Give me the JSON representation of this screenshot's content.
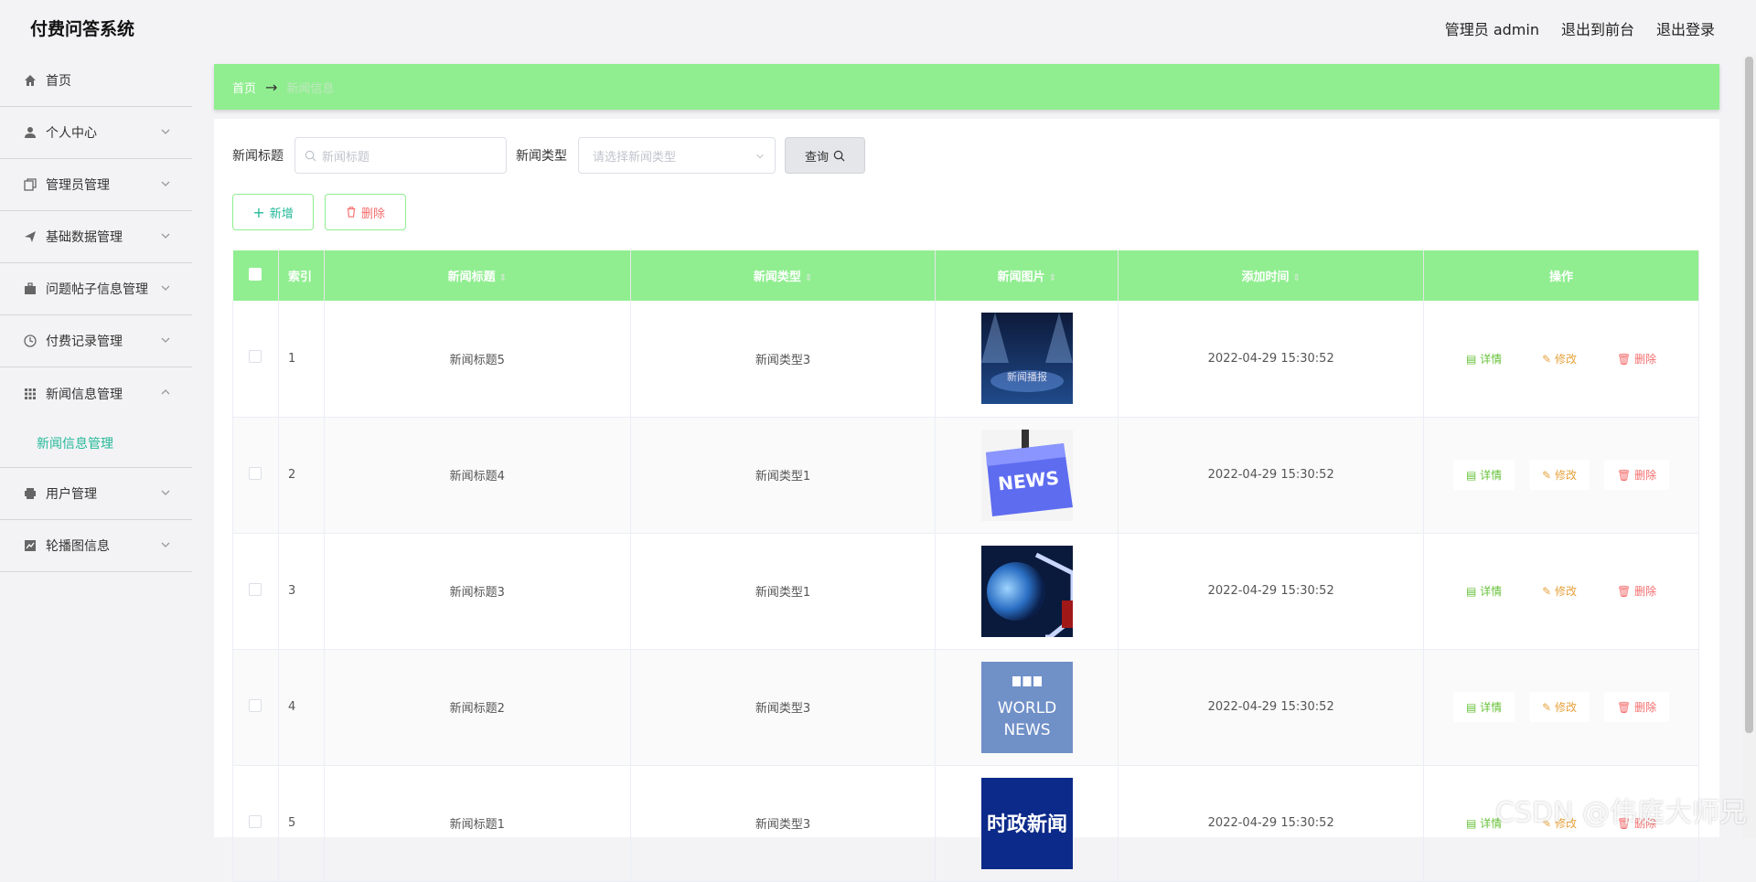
{
  "app": {
    "title": "付费问答系统"
  },
  "top_links": {
    "user": "管理员 admin",
    "front": "退出到前台",
    "logout": "退出登录"
  },
  "sidebar": {
    "items": [
      {
        "label": "首页",
        "icon": "home-icon"
      },
      {
        "label": "个人中心",
        "icon": "user-icon"
      },
      {
        "label": "管理员管理",
        "icon": "copy-icon"
      },
      {
        "label": "基础数据管理",
        "icon": "send-icon"
      },
      {
        "label": "问题帖子信息管理",
        "icon": "briefcase-icon"
      },
      {
        "label": "付费记录管理",
        "icon": "clock-icon"
      },
      {
        "label": "新闻信息管理",
        "icon": "grid-icon"
      },
      {
        "label": "用户管理",
        "icon": "printer-icon"
      },
      {
        "label": "轮播图信息",
        "icon": "chart-icon"
      }
    ],
    "submenu": {
      "label": "新闻信息管理"
    }
  },
  "breadcrumb": {
    "home": "首页",
    "sep": "→",
    "current": "新闻信息"
  },
  "search": {
    "title_label": "新闻标题",
    "title_placeholder": "新闻标题",
    "type_label": "新闻类型",
    "type_placeholder": "请选择新闻类型",
    "query_button": "查询"
  },
  "actions": {
    "add": "新增",
    "delete": "删除"
  },
  "table": {
    "headers": {
      "index": "索引",
      "title": "新闻标题",
      "type": "新闻类型",
      "image": "新闻图片",
      "time": "添加时间",
      "ops": "操作"
    },
    "ops": {
      "detail": "详情",
      "edit": "修改",
      "delete": "删除"
    },
    "rows": [
      {
        "index": "1",
        "title": "新闻标题5",
        "type": "新闻类型3",
        "time": "2022-04-29 15:30:52",
        "image_text": "新闻播报"
      },
      {
        "index": "2",
        "title": "新闻标题4",
        "type": "新闻类型1",
        "time": "2022-04-29 15:30:52",
        "image_text": "NEWS"
      },
      {
        "index": "3",
        "title": "新闻标题3",
        "type": "新闻类型1",
        "time": "2022-04-29 15:30:52",
        "image_text": ""
      },
      {
        "index": "4",
        "title": "新闻标题2",
        "type": "新闻类型3",
        "time": "2022-04-29 15:30:52",
        "image_text": "BBC WORLD NEWS"
      },
      {
        "index": "5",
        "title": "新闻标题1",
        "type": "新闻类型3",
        "time": "2022-04-29 15:30:52",
        "image_text": "时政新闻"
      }
    ]
  },
  "watermark": "CSDN @伟庭大师兄",
  "colors": {
    "accent": "#90ee90",
    "primary_text": "#26b99a",
    "danger": "#f56c6c",
    "warning": "#e6a23c",
    "success": "#67c23a"
  }
}
